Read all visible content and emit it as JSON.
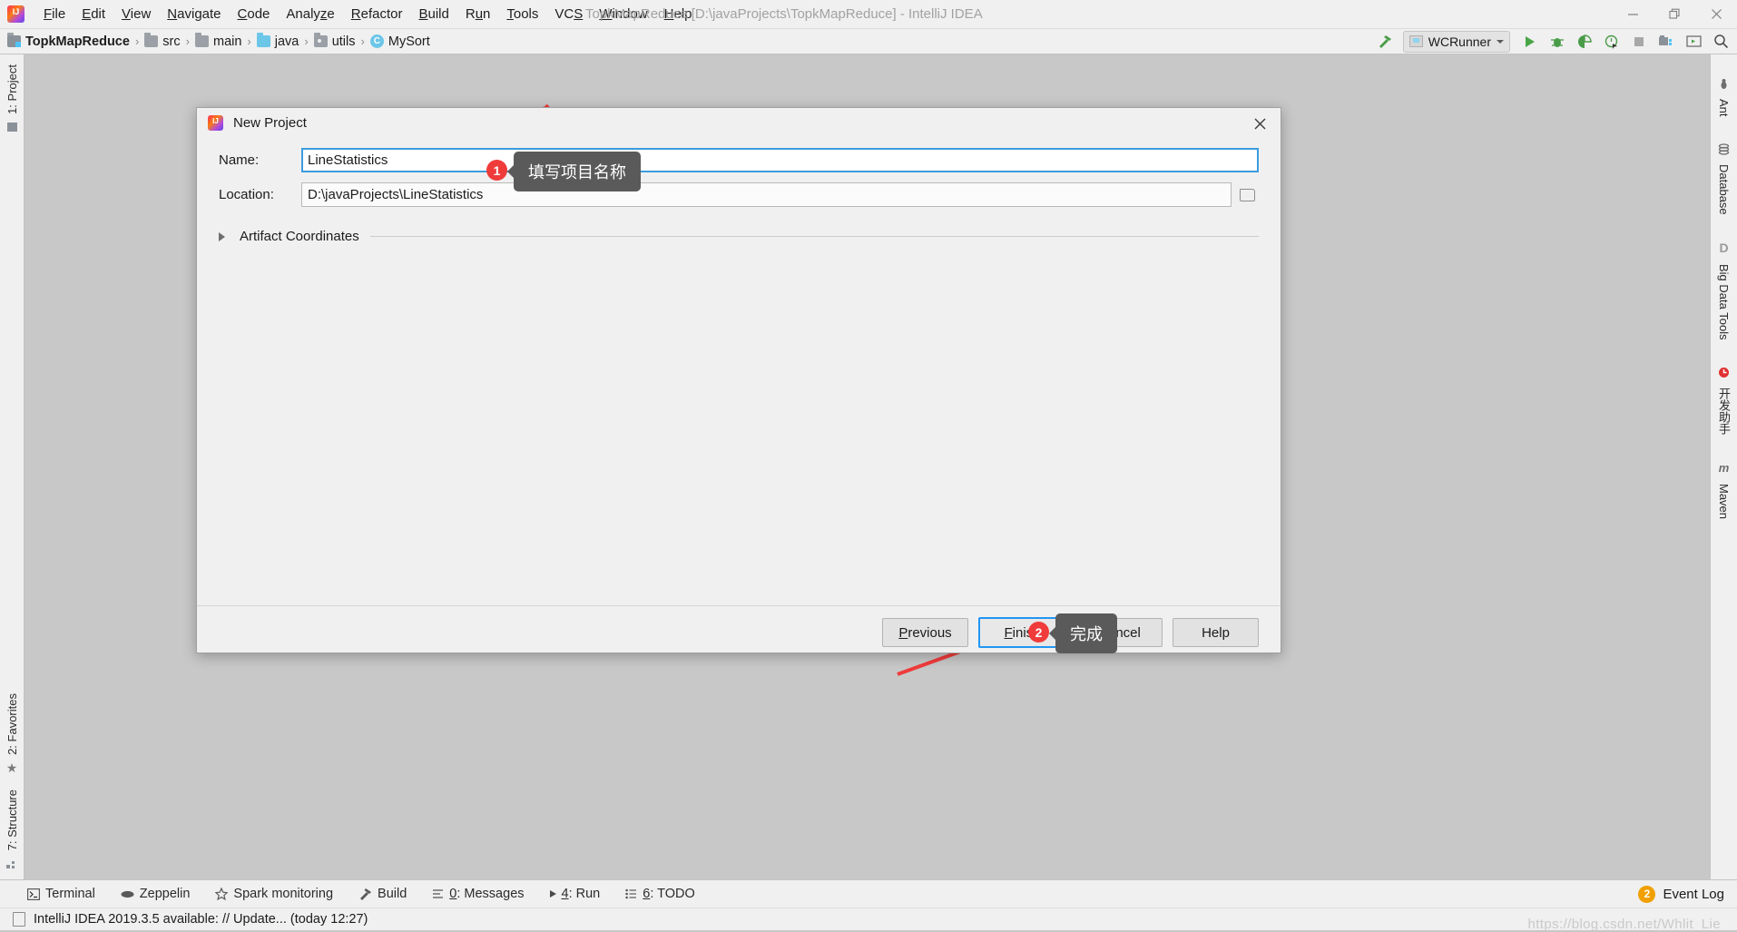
{
  "window": {
    "title": "TopkMapReduce [D:\\javaProjects\\TopkMapReduce] - IntelliJ IDEA",
    "minimize_icon": "minimize-icon",
    "maximize_icon": "restore-icon",
    "close_icon": "close-icon"
  },
  "menubar": {
    "items": [
      {
        "label": "File",
        "mnemonic": "F"
      },
      {
        "label": "Edit",
        "mnemonic": "E"
      },
      {
        "label": "View",
        "mnemonic": "V"
      },
      {
        "label": "Navigate",
        "mnemonic": "N"
      },
      {
        "label": "Code",
        "mnemonic": "C"
      },
      {
        "label": "Analyze",
        "mnemonic": "z"
      },
      {
        "label": "Refactor",
        "mnemonic": "R"
      },
      {
        "label": "Build",
        "mnemonic": "B"
      },
      {
        "label": "Run",
        "mnemonic": "u"
      },
      {
        "label": "Tools",
        "mnemonic": "T"
      },
      {
        "label": "VCS",
        "mnemonic": "S"
      },
      {
        "label": "Window",
        "mnemonic": "W"
      },
      {
        "label": "Help",
        "mnemonic": "H"
      }
    ]
  },
  "navbar": {
    "crumbs": [
      {
        "label": "TopkMapReduce",
        "icon": "project-folder-icon"
      },
      {
        "label": "src",
        "icon": "folder-icon"
      },
      {
        "label": "main",
        "icon": "folder-icon"
      },
      {
        "label": "java",
        "icon": "source-folder-icon"
      },
      {
        "label": "utils",
        "icon": "package-folder-icon"
      },
      {
        "label": "MySort",
        "icon": "class-icon"
      }
    ],
    "separator": "›",
    "run_config": "WCRunner",
    "toolbar_icons": [
      "build-hammer-icon",
      "run-icon",
      "debug-icon",
      "run-with-coverage-icon",
      "profiler-icon",
      "stop-icon",
      "project-structure-icon",
      "terminal-icon",
      "search-everywhere-icon"
    ]
  },
  "left_sidebar": {
    "top": [
      {
        "label": "1: Project",
        "icon": "project-icon"
      }
    ],
    "bottom": [
      {
        "label": "2: Favorites",
        "icon": "star-icon"
      },
      {
        "label": "7: Structure",
        "icon": "structure-icon"
      }
    ]
  },
  "right_sidebar": {
    "items": [
      {
        "label": "Ant",
        "icon": "ant-icon"
      },
      {
        "label": "Database",
        "icon": "database-icon"
      },
      {
        "label": "Big Data Tools",
        "icon": "big-data-tools-icon"
      },
      {
        "label": "开发助手",
        "icon": "dev-assistant-icon"
      },
      {
        "label": "Maven",
        "icon": "maven-icon"
      }
    ]
  },
  "dialog": {
    "title": "New Project",
    "close_label": "✕",
    "name": {
      "label": "Name:",
      "value": "LineStatistics",
      "placeholder": ""
    },
    "location": {
      "label": "Location:",
      "value": "D:\\javaProjects\\LineStatistics",
      "placeholder": "",
      "browse_icon": "folder-browse-icon"
    },
    "artifact_coordinates": {
      "label": "Artifact Coordinates",
      "expander_icon": "chevron-right-icon",
      "expanded": false
    },
    "buttons": [
      {
        "label": "Previous",
        "mnemonic": "P",
        "primary": false
      },
      {
        "label": "Finish",
        "mnemonic": "F",
        "primary": true
      },
      {
        "label": "Cancel",
        "mnemonic": "",
        "primary": false
      },
      {
        "label": "Help",
        "mnemonic": "",
        "primary": false
      }
    ]
  },
  "annotations": [
    {
      "number": "1",
      "text": "填写项目名称"
    },
    {
      "number": "2",
      "text": "完成"
    }
  ],
  "toolwindow_bar": {
    "items": [
      {
        "label": "Terminal",
        "icon": "terminal-icon",
        "mnemonic": ""
      },
      {
        "label": "Zeppelin",
        "icon": "zeppelin-icon",
        "mnemonic": ""
      },
      {
        "label": "Spark monitoring",
        "icon": "spark-star-icon",
        "mnemonic": ""
      },
      {
        "label": "Build",
        "icon": "build-hammer-icon",
        "mnemonic": ""
      },
      {
        "label": "0: Messages",
        "icon": "messages-icon",
        "mnemonic": "0"
      },
      {
        "label": "4: Run",
        "icon": "run-icon",
        "mnemonic": "4"
      },
      {
        "label": "6: TODO",
        "icon": "todo-icon",
        "mnemonic": "6"
      }
    ],
    "event_log": {
      "label": "Event Log",
      "count": "2",
      "icon": "event-log-icon"
    }
  },
  "statusbar": {
    "message": "IntelliJ IDEA 2019.3.5 available: // Update... (today 12:27)",
    "icon": "notification-icon",
    "watermark": "https://blog.csdn.net/Whlit_Lie"
  },
  "colors": {
    "accent_blue": "#2196f3",
    "annotation_red": "#f03b3b",
    "tooltip_gray": "#5a5a5a",
    "event_badge": "#f0a000"
  }
}
